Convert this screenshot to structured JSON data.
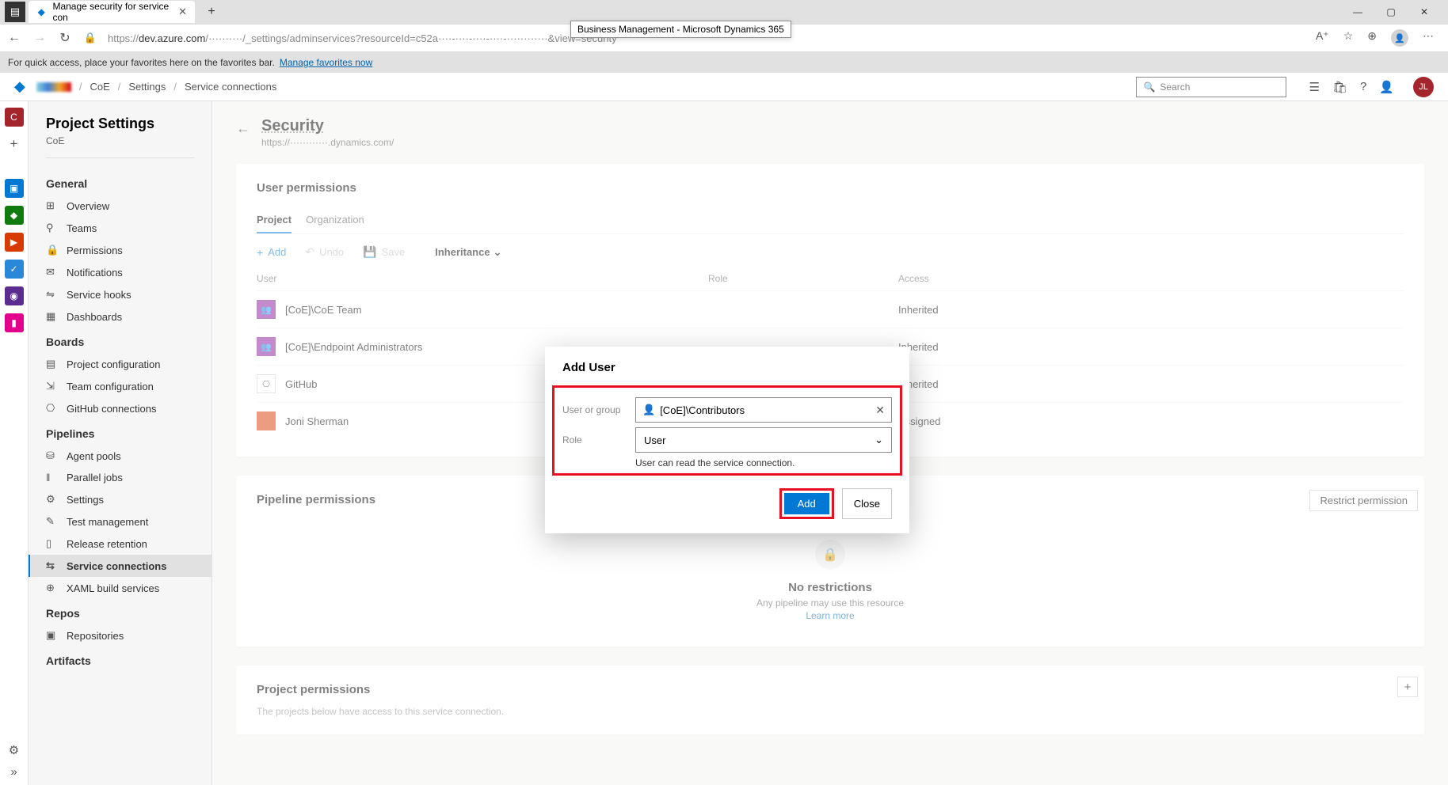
{
  "browser": {
    "tab_title": "Manage security for service con",
    "tooltip": "Business Management - Microsoft Dynamics 365",
    "url_prefix": "https://",
    "url_host": "dev.azure.com",
    "url_path": "/··········/_settings/adminservices?resourceId=c52a····-····-····-····-············&view=security",
    "fav_prompt": "For quick access, place your favorites here on the favorites bar.",
    "fav_link": "Manage favorites now",
    "win_min": "—",
    "win_max": "▢",
    "win_close": "✕"
  },
  "topbar": {
    "breadcrumb": [
      "CoE",
      "Settings",
      "Service connections"
    ],
    "search_placeholder": "Search",
    "avatar": "JL"
  },
  "sidebar": {
    "title": "Project Settings",
    "subtitle": "CoE",
    "sections": [
      {
        "name": "General",
        "items": [
          {
            "icon": "⊞",
            "label": "Overview"
          },
          {
            "icon": "⚲",
            "label": "Teams"
          },
          {
            "icon": "🔒",
            "label": "Permissions"
          },
          {
            "icon": "✉",
            "label": "Notifications"
          },
          {
            "icon": "⇋",
            "label": "Service hooks"
          },
          {
            "icon": "▦",
            "label": "Dashboards"
          }
        ]
      },
      {
        "name": "Boards",
        "items": [
          {
            "icon": "▤",
            "label": "Project configuration"
          },
          {
            "icon": "⇲",
            "label": "Team configuration"
          },
          {
            "icon": "⎔",
            "label": "GitHub connections"
          }
        ]
      },
      {
        "name": "Pipelines",
        "items": [
          {
            "icon": "⛁",
            "label": "Agent pools"
          },
          {
            "icon": "‖",
            "label": "Parallel jobs"
          },
          {
            "icon": "⚙",
            "label": "Settings"
          },
          {
            "icon": "✎",
            "label": "Test management"
          },
          {
            "icon": "▯",
            "label": "Release retention"
          },
          {
            "icon": "⇆",
            "label": "Service connections",
            "active": true
          },
          {
            "icon": "⊕",
            "label": "XAML build services"
          }
        ]
      },
      {
        "name": "Repos",
        "items": [
          {
            "icon": "▣",
            "label": "Repositories"
          }
        ]
      },
      {
        "name": "Artifacts",
        "items": []
      }
    ]
  },
  "content": {
    "title": "Security",
    "subtitle": "https://············.dynamics.com/",
    "user_perms": {
      "heading": "User permissions",
      "tabs": [
        "Project",
        "Organization"
      ],
      "active_tab": "Project",
      "actions": {
        "add": "Add",
        "undo": "Undo",
        "save": "Save",
        "inheritance": "Inheritance"
      },
      "columns": [
        "User",
        "Role",
        "Access"
      ],
      "rows": [
        {
          "avatar": "grp",
          "name": "[CoE]\\CoE Team",
          "role": "",
          "access": "Inherited"
        },
        {
          "avatar": "grp",
          "name": "[CoE]\\Endpoint Administrators",
          "role": "",
          "access": "Inherited"
        },
        {
          "avatar": "gh",
          "name": "GitHub",
          "role": "",
          "access": "Inherited"
        },
        {
          "avatar": "usr",
          "name": "Joni Sherman",
          "role": "",
          "access": "Assigned"
        }
      ]
    },
    "pipeline": {
      "heading": "Pipeline permissions",
      "restrict_btn": "Restrict permission",
      "empty_title": "No restrictions",
      "empty_sub": "Any pipeline may use this resource",
      "learn": "Learn more"
    },
    "project": {
      "heading": "Project permissions",
      "sub": "The projects below have access to this service connection."
    }
  },
  "dialog": {
    "title": "Add User",
    "user_label": "User or group",
    "user_value": "[CoE]\\Contributors",
    "role_label": "Role",
    "role_value": "User",
    "help": "User can read the service connection.",
    "add": "Add",
    "close": "Close"
  }
}
